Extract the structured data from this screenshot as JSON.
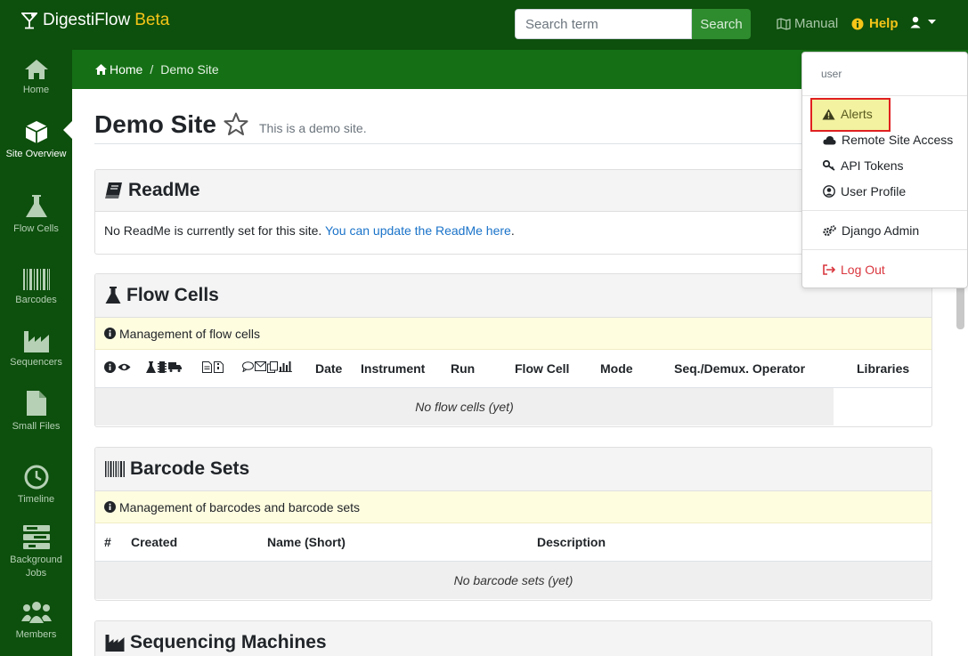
{
  "brand": {
    "name": "DigestiFlow",
    "suffix": "Beta"
  },
  "search": {
    "placeholder": "Search term",
    "button": "Search"
  },
  "topnav": {
    "manual": "Manual",
    "help": "Help"
  },
  "sidebar": {
    "items": [
      {
        "label": "Home",
        "icon": "home-icon"
      },
      {
        "label": "Site Overview",
        "icon": "cube-icon",
        "active": true
      },
      {
        "label": "Flow Cells",
        "icon": "flask-icon"
      },
      {
        "label": "Barcodes",
        "icon": "barcode-icon"
      },
      {
        "label": "Sequencers",
        "icon": "industry-icon"
      },
      {
        "label": "Small Files",
        "icon": "file-icon"
      },
      {
        "label": "Timeline",
        "icon": "clock-icon"
      },
      {
        "label": "Background Jobs",
        "icon": "tasks-icon"
      },
      {
        "label": "Members",
        "icon": "users-icon"
      }
    ]
  },
  "breadcrumb": {
    "home": "Home",
    "current": "Demo Site"
  },
  "page": {
    "title": "Demo Site",
    "subtitle": "This is a demo site."
  },
  "readme": {
    "title": "ReadMe",
    "text": "No ReadMe is currently set for this site.",
    "link": "You can update the ReadMe here",
    "link_tail": "."
  },
  "flowcells": {
    "title": "Flow Cells",
    "info": "Management of flow cells",
    "columns": [
      "Date",
      "Instrument",
      "Run",
      "Flow Cell",
      "Mode",
      "Seq./Demux. Operator",
      "Libraries"
    ],
    "empty": "No flow cells (yet)"
  },
  "barcodes": {
    "title": "Barcode Sets",
    "info": "Management of barcodes and barcode sets",
    "columns": [
      "#",
      "Created",
      "Name (Short)",
      "Description"
    ],
    "empty": "No barcode sets (yet)"
  },
  "sequencers": {
    "title": "Sequencing Machines"
  },
  "user_menu": {
    "header": "user",
    "items": {
      "alerts": "Alerts",
      "remote": "Remote Site Access",
      "tokens": "API Tokens",
      "profile": "User Profile",
      "django": "Django Admin",
      "logout": "Log Out"
    }
  },
  "colors": {
    "navbar": "#0d4f0d",
    "breadcrumb": "#157015",
    "accent": "#f5c518",
    "highlight": "#e02020"
  }
}
